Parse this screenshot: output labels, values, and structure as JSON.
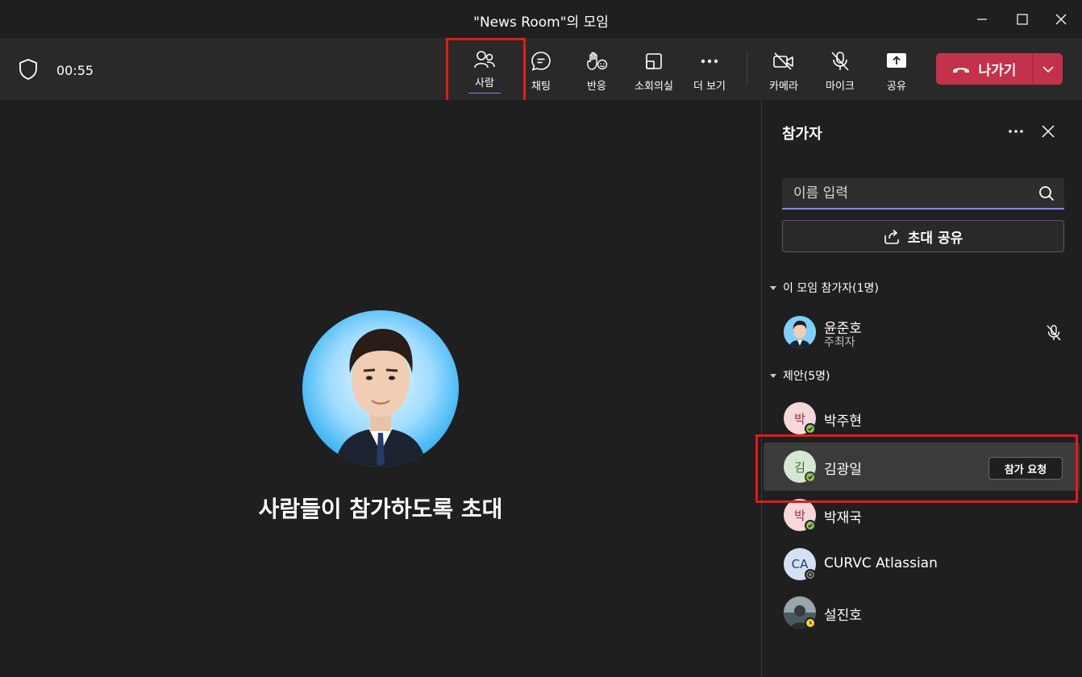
{
  "window": {
    "title": "\"News Room\"의 모임"
  },
  "toolbar": {
    "timer": "00:55",
    "people_label": "사람",
    "chat_label": "채팅",
    "react_label": "반응",
    "rooms_label": "소회의실",
    "more_label": "더 보기",
    "camera_label": "카메라",
    "mic_label": "마이크",
    "share_label": "공유",
    "leave_label": "나가기"
  },
  "stage": {
    "invite_text": "사람들이 참가하도록 초대"
  },
  "panel": {
    "title": "참가자",
    "search_placeholder": "이름 입력",
    "share_invite_label": "초대 공유",
    "in_meeting_header": "이 모임 참가자(1명)",
    "suggestions_header": "제안(5명)",
    "host": {
      "name": "윤준호",
      "role": "주최자"
    },
    "suggestions": [
      {
        "name": "박주현",
        "initials": "박",
        "status": "available"
      },
      {
        "name": "김광일",
        "initials": "김",
        "status": "available",
        "action": "참가 요청"
      },
      {
        "name": "박재국",
        "initials": "박",
        "status": "available"
      },
      {
        "name": "CURVC Atlassian",
        "initials": "CA",
        "status": "offline"
      },
      {
        "name": "설진호",
        "initials": "",
        "status": "away"
      }
    ]
  },
  "colors": {
    "accent": "#7f85f5",
    "leave": "#c4314b",
    "highlight": "#e21b1b",
    "available": "#92c353",
    "away": "#f8d22a"
  }
}
